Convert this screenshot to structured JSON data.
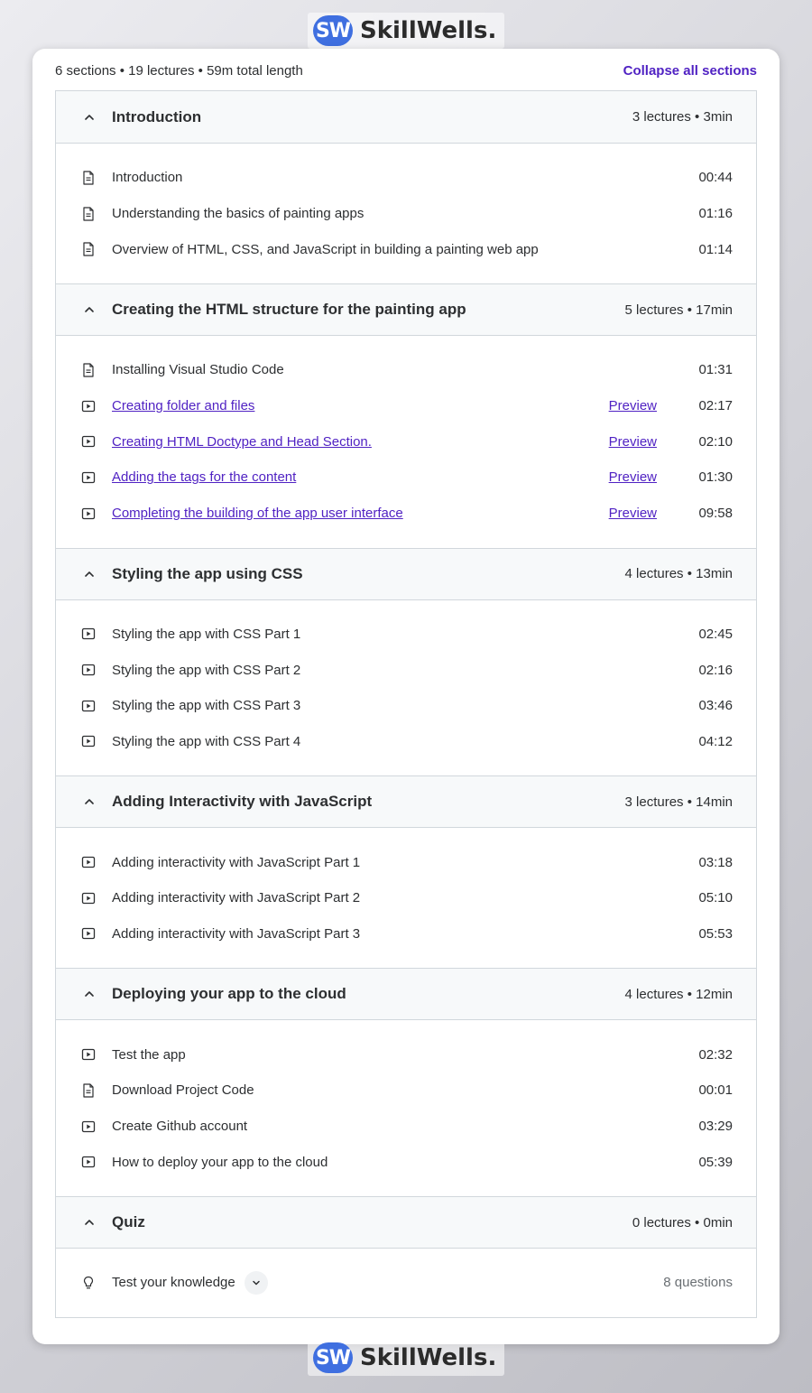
{
  "brand": {
    "badge": "SW",
    "name": "SkillWells."
  },
  "summary": "6 sections • 19 lectures • 59m total length",
  "collapse_all": "Collapse all sections",
  "colors": {
    "accent": "#5022c3",
    "header_bg": "#f7f9fa",
    "border": "#d1d7dc",
    "logo_badge": "#3f6fe0"
  },
  "sections": [
    {
      "title": "Introduction",
      "meta": "3 lectures • 3min",
      "lectures": [
        {
          "icon": "document-icon",
          "title": "Introduction",
          "time": "00:44",
          "preview": ""
        },
        {
          "icon": "document-icon",
          "title": "Understanding the basics of painting apps",
          "time": "01:16",
          "preview": ""
        },
        {
          "icon": "document-icon",
          "title": "Overview of HTML, CSS, and JavaScript in building a painting web app",
          "time": "01:14",
          "preview": ""
        }
      ]
    },
    {
      "title": "Creating the HTML structure for the painting app",
      "meta": "5 lectures • 17min",
      "lectures": [
        {
          "icon": "document-icon",
          "title": "Installing Visual Studio Code",
          "time": "01:31",
          "preview": ""
        },
        {
          "icon": "video-icon",
          "title": "Creating folder and files",
          "time": "02:17",
          "preview": "Preview"
        },
        {
          "icon": "video-icon",
          "title": "Creating HTML Doctype and Head Section.",
          "time": "02:10",
          "preview": "Preview"
        },
        {
          "icon": "video-icon",
          "title": "Adding the tags for the content",
          "time": "01:30",
          "preview": "Preview"
        },
        {
          "icon": "video-icon",
          "title": "Completing the building of the app user interface",
          "time": "09:58",
          "preview": "Preview"
        }
      ]
    },
    {
      "title": "Styling the app using CSS",
      "meta": "4 lectures • 13min",
      "lectures": [
        {
          "icon": "video-icon",
          "title": "Styling the app with CSS Part 1",
          "time": "02:45",
          "preview": ""
        },
        {
          "icon": "video-icon",
          "title": "Styling the app with CSS Part 2",
          "time": "02:16",
          "preview": ""
        },
        {
          "icon": "video-icon",
          "title": "Styling the app with CSS Part 3",
          "time": "03:46",
          "preview": ""
        },
        {
          "icon": "video-icon",
          "title": "Styling the app with CSS Part 4",
          "time": "04:12",
          "preview": ""
        }
      ]
    },
    {
      "title": "Adding Interactivity with JavaScript",
      "meta": "3 lectures • 14min",
      "lectures": [
        {
          "icon": "video-icon",
          "title": "Adding interactivity with JavaScript Part 1",
          "time": "03:18",
          "preview": ""
        },
        {
          "icon": "video-icon",
          "title": "Adding interactivity with JavaScript Part 2",
          "time": "05:10",
          "preview": ""
        },
        {
          "icon": "video-icon",
          "title": "Adding interactivity with JavaScript Part 3",
          "time": "05:53",
          "preview": ""
        }
      ]
    },
    {
      "title": "Deploying your app to the cloud",
      "meta": "4 lectures • 12min",
      "lectures": [
        {
          "icon": "video-icon",
          "title": "Test the app",
          "time": "02:32",
          "preview": ""
        },
        {
          "icon": "document-icon",
          "title": "Download Project Code",
          "time": "00:01",
          "preview": ""
        },
        {
          "icon": "video-icon",
          "title": "Create Github account",
          "time": "03:29",
          "preview": ""
        },
        {
          "icon": "video-icon",
          "title": "How to deploy your app to the cloud",
          "time": "05:39",
          "preview": ""
        }
      ]
    },
    {
      "title": "Quiz",
      "meta": "0 lectures • 0min",
      "quiz": {
        "icon": "lightbulb-icon",
        "title": "Test your knowledge",
        "questions": "8 questions"
      }
    }
  ]
}
